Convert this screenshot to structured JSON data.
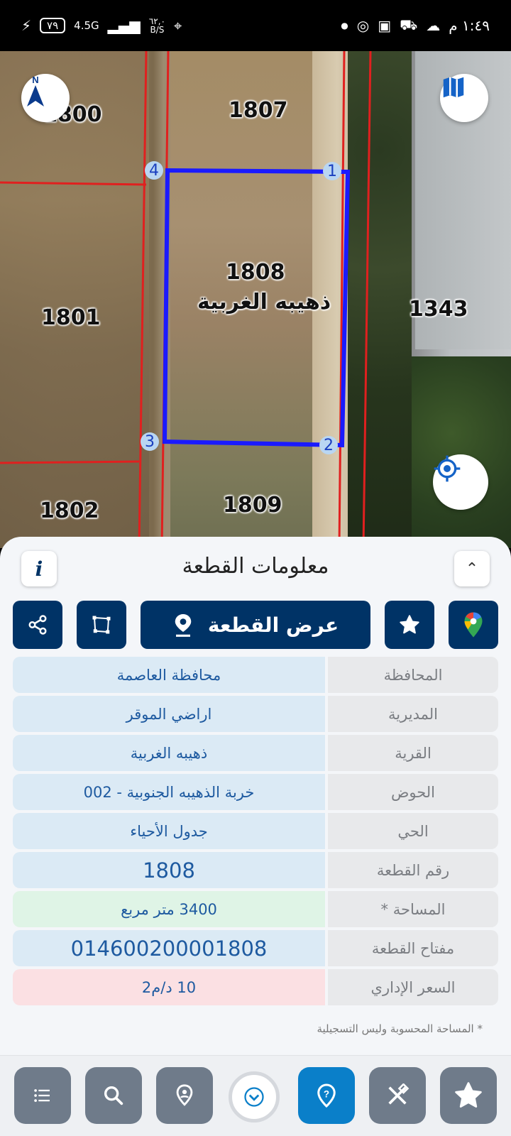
{
  "status_bar": {
    "time": "١:٤٩ م",
    "battery": "٧٩",
    "network": "4.5G",
    "speed_value": "٦٢,٠",
    "speed_unit": "B/S"
  },
  "map": {
    "compass_label": "N",
    "parcels": [
      {
        "id": "1800"
      },
      {
        "id": "1807"
      },
      {
        "id": "1801"
      },
      {
        "id": "1343"
      },
      {
        "id": "1802"
      },
      {
        "id": "1809"
      }
    ],
    "selected": {
      "number": "1808",
      "village": "ذهيبه الغربية"
    },
    "vertices": [
      "1",
      "2",
      "3",
      "4"
    ]
  },
  "sheet": {
    "title": "معلومات القطعة",
    "show_parcel_button": "عرض القطعة",
    "info_button": "i",
    "fields": [
      {
        "label": "المحافظة",
        "value": "محافظة العاصمة",
        "style": "blue"
      },
      {
        "label": "المديرية",
        "value": "اراضي الموقر",
        "style": "blue"
      },
      {
        "label": "القرية",
        "value": "ذهيبه الغربية",
        "style": "blue"
      },
      {
        "label": "الحوض",
        "value": "خربة الذهيبه الجنوبية - 002",
        "style": "blue"
      },
      {
        "label": "الحي",
        "value": "جدول الأحياء",
        "style": "blue"
      },
      {
        "label": "رقم القطعة",
        "value": "1808",
        "style": "blue-big"
      },
      {
        "label": "المساحة *",
        "value": "3400  متر مربع",
        "style": "green"
      },
      {
        "label": "مفتاح القطعة",
        "value": "014600200001808",
        "style": "blue-big"
      },
      {
        "label": "السعر الإداري",
        "value": "10 د/م2",
        "style": "red"
      }
    ],
    "footnote": "* المساحة المحسوبة وليس التسجيلية"
  },
  "colors": {
    "navy": "#003366",
    "active": "#0a7fc9",
    "parcel_outline": "#1a1aff",
    "boundary": "#e0201f"
  }
}
